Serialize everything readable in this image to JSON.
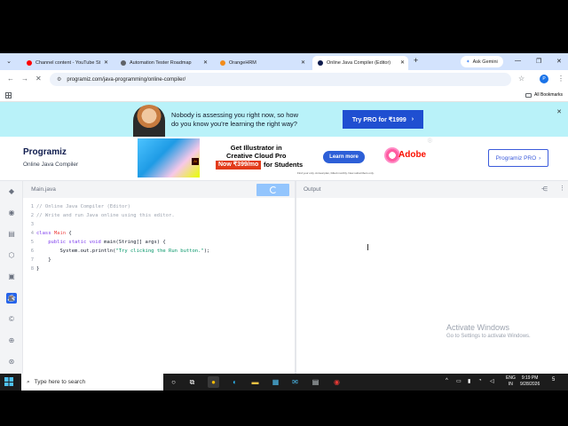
{
  "browser": {
    "tabs": [
      {
        "title": "Channel content - YouTube St",
        "favicon_color": "#ff0000",
        "active": false
      },
      {
        "title": "Automation Tester Roadmap",
        "favicon_color": "#5f6368",
        "active": false
      },
      {
        "title": "OrangeHRM",
        "favicon_color": "#f28c1b",
        "active": false
      },
      {
        "title": "Online Java Compiler (Editor)",
        "favicon_color": "#0e1b4d",
        "active": true
      }
    ],
    "gemini_label": "Ask Gemini",
    "url": "programiz.com/java-programming/online-compiler/",
    "profile_initial": "P",
    "all_bookmarks": "All Bookmarks"
  },
  "promo": {
    "text_line1": "Nobody is assessing you right now, so how",
    "text_line2": "do you know you're learning the right way?",
    "button": "Try PRO for ₹1999"
  },
  "site": {
    "logo": "Programiz",
    "subtitle": "Online Java Compiler",
    "pro_button": "Programiz PRO"
  },
  "ad": {
    "headline1": "Get Illustrator in",
    "headline2": "Creative Cloud Pro",
    "price": "Now ₹399/mo",
    "for_students": "for Students",
    "learn_more": "Learn more",
    "brand": "Adobe",
    "ai_badge": "Ai",
    "fineprint": "Find your only. Annual plan, billed monthly. New subscribers only."
  },
  "editor": {
    "file_tab": "Main.java",
    "lines": [
      {
        "n": "1",
        "segments": [
          {
            "cls": "cmt",
            "text": "// Online Java Compiler (Editor)"
          }
        ]
      },
      {
        "n": "2",
        "segments": [
          {
            "cls": "cmt",
            "text": "// Write and run Java online using this editor."
          }
        ]
      },
      {
        "n": "3",
        "segments": []
      },
      {
        "n": "4",
        "segments": [
          {
            "cls": "kw",
            "text": "class "
          },
          {
            "cls": "cls",
            "text": "Main"
          },
          {
            "cls": "plain",
            "text": " {"
          }
        ]
      },
      {
        "n": "5",
        "segments": [
          {
            "cls": "plain",
            "text": "    "
          },
          {
            "cls": "kw",
            "text": "public static void "
          },
          {
            "cls": "plain",
            "text": "main(String[] args) {"
          }
        ]
      },
      {
        "n": "6",
        "segments": [
          {
            "cls": "plain",
            "text": "        System.out.println("
          },
          {
            "cls": "str",
            "text": "\"Try clicking the Run button.\""
          },
          {
            "cls": "plain",
            "text": ");"
          }
        ]
      },
      {
        "n": "7",
        "segments": [
          {
            "cls": "plain",
            "text": "    }"
          }
        ]
      },
      {
        "n": "8",
        "segments": [
          {
            "cls": "plain",
            "text": "}"
          }
        ]
      }
    ]
  },
  "output": {
    "label": "Output"
  },
  "watermark": {
    "line1": "Activate Windows",
    "line2": "Go to Settings to activate Windows."
  },
  "taskbar": {
    "search_placeholder": "Type here to search",
    "lang1": "ENG",
    "lang2": "IN",
    "time": "9:19 PM",
    "date": "9/28/2026",
    "notif_count": "5"
  }
}
